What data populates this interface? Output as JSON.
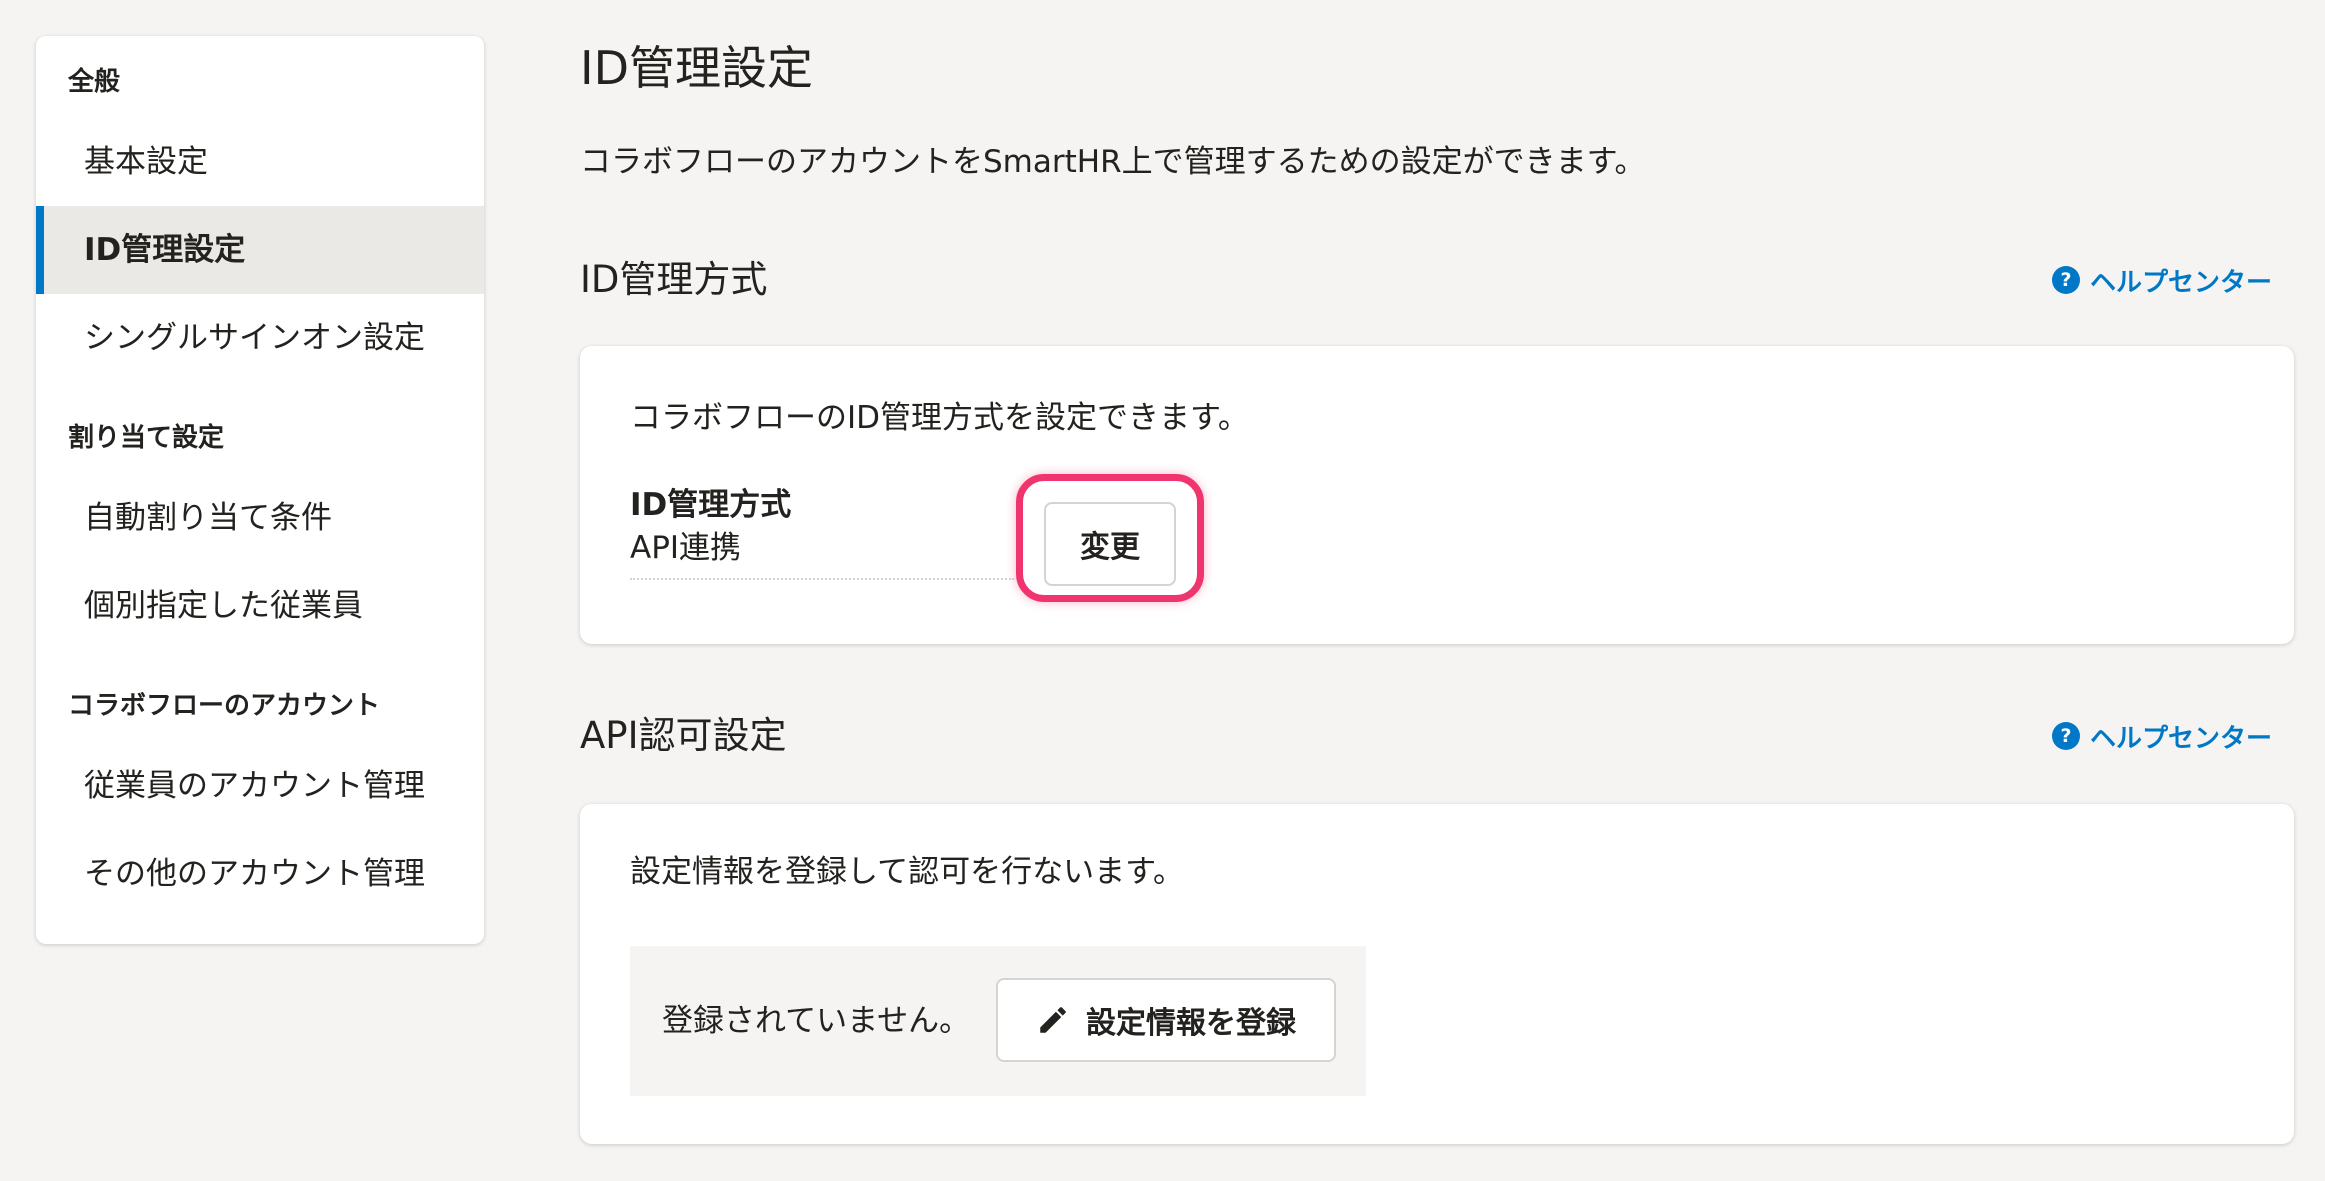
{
  "sidebar": {
    "groups": [
      {
        "heading": "全般",
        "items": [
          {
            "label": "基本設定",
            "active": false
          },
          {
            "label": "ID管理設定",
            "active": true
          },
          {
            "label": "シングルサインオン設定",
            "active": false
          }
        ]
      },
      {
        "heading": "割り当て設定",
        "items": [
          {
            "label": "自動割り当て条件",
            "active": false
          },
          {
            "label": "個別指定した従業員",
            "active": false
          }
        ]
      },
      {
        "heading": "コラボフローのアカウント",
        "items": [
          {
            "label": "従業員のアカウント管理",
            "active": false
          },
          {
            "label": "その他のアカウント管理",
            "active": false
          }
        ]
      }
    ]
  },
  "page": {
    "title": "ID管理設定",
    "description": "コラボフローのアカウントをSmartHR上で管理するための設定ができます。"
  },
  "id_management": {
    "title": "ID管理方式",
    "help_label": "ヘルプセンター",
    "description": "コラボフローのID管理方式を設定できます。",
    "field_label": "ID管理方式",
    "field_value": "API連携",
    "change_button": "変更"
  },
  "api_auth": {
    "title": "API認可設定",
    "help_label": "ヘルプセンター",
    "description": "設定情報を登録して認可を行ないます。",
    "status": "登録されていません。",
    "register_button": "設定情報を登録"
  },
  "colors": {
    "accent": "#0077c7",
    "highlight": "#f0346e",
    "background": "#f5f4f2"
  },
  "icons": {
    "help": "question-circle-icon",
    "register": "pencil-icon"
  }
}
